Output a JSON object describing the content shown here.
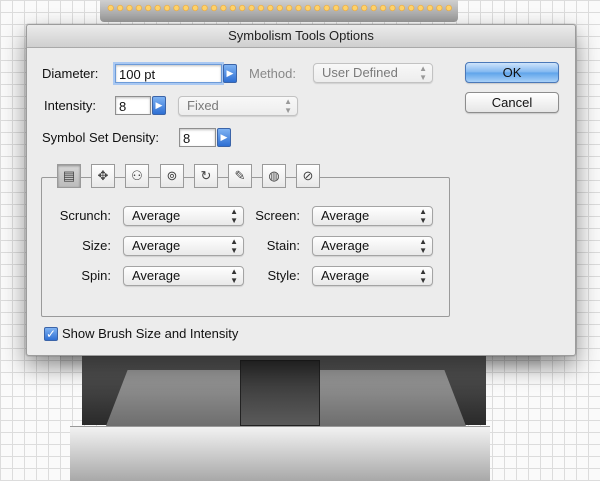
{
  "dialog": {
    "title": "Symbolism Tools Options",
    "diameter": {
      "label": "Diameter:",
      "value": "100 pt"
    },
    "method": {
      "label": "Method:",
      "value": "User Defined"
    },
    "intensity": {
      "label": "Intensity:",
      "value": "8",
      "mode": "Fixed"
    },
    "density": {
      "label": "Symbol Set Density:",
      "value": "8"
    },
    "buttons": {
      "ok": "OK",
      "cancel": "Cancel"
    },
    "tools": [
      {
        "name": "symbol-sprayer-icon"
      },
      {
        "name": "symbol-shifter-icon"
      },
      {
        "name": "symbol-scruncher-icon"
      },
      {
        "name": "symbol-sizer-icon"
      },
      {
        "name": "symbol-spinner-icon"
      },
      {
        "name": "symbol-stainer-icon"
      },
      {
        "name": "symbol-screener-icon"
      },
      {
        "name": "symbol-styler-icon"
      }
    ],
    "settings": {
      "scrunch": {
        "label": "Scrunch:",
        "value": "Average"
      },
      "size": {
        "label": "Size:",
        "value": "Average"
      },
      "spin": {
        "label": "Spin:",
        "value": "Average"
      },
      "screen": {
        "label": "Screen:",
        "value": "Average"
      },
      "stain": {
        "label": "Stain:",
        "value": "Average"
      },
      "style": {
        "label": "Style:",
        "value": "Average"
      }
    },
    "show_brush": {
      "label": "Show Brush Size and Intensity",
      "checked": true
    }
  },
  "colors": {
    "accent": "#4a90e2",
    "dialog_bg": "#ececec"
  }
}
